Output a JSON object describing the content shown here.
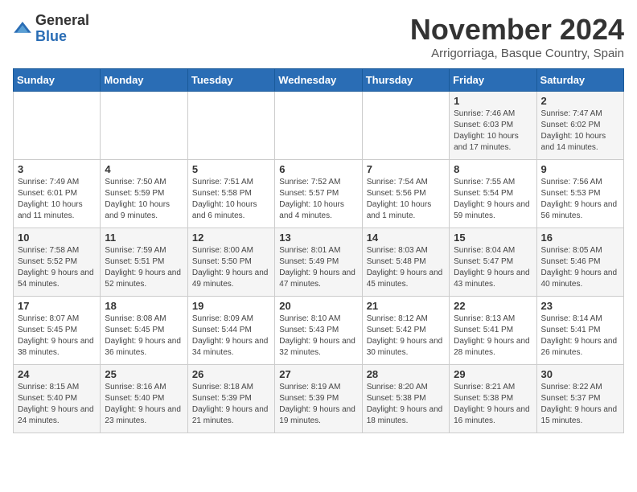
{
  "logo": {
    "general": "General",
    "blue": "Blue"
  },
  "title": "November 2024",
  "location": "Arrigorriaga, Basque Country, Spain",
  "days_of_week": [
    "Sunday",
    "Monday",
    "Tuesday",
    "Wednesday",
    "Thursday",
    "Friday",
    "Saturday"
  ],
  "weeks": [
    [
      {
        "day": "",
        "info": ""
      },
      {
        "day": "",
        "info": ""
      },
      {
        "day": "",
        "info": ""
      },
      {
        "day": "",
        "info": ""
      },
      {
        "day": "",
        "info": ""
      },
      {
        "day": "1",
        "info": "Sunrise: 7:46 AM\nSunset: 6:03 PM\nDaylight: 10 hours and 17 minutes."
      },
      {
        "day": "2",
        "info": "Sunrise: 7:47 AM\nSunset: 6:02 PM\nDaylight: 10 hours and 14 minutes."
      }
    ],
    [
      {
        "day": "3",
        "info": "Sunrise: 7:49 AM\nSunset: 6:01 PM\nDaylight: 10 hours and 11 minutes."
      },
      {
        "day": "4",
        "info": "Sunrise: 7:50 AM\nSunset: 5:59 PM\nDaylight: 10 hours and 9 minutes."
      },
      {
        "day": "5",
        "info": "Sunrise: 7:51 AM\nSunset: 5:58 PM\nDaylight: 10 hours and 6 minutes."
      },
      {
        "day": "6",
        "info": "Sunrise: 7:52 AM\nSunset: 5:57 PM\nDaylight: 10 hours and 4 minutes."
      },
      {
        "day": "7",
        "info": "Sunrise: 7:54 AM\nSunset: 5:56 PM\nDaylight: 10 hours and 1 minute."
      },
      {
        "day": "8",
        "info": "Sunrise: 7:55 AM\nSunset: 5:54 PM\nDaylight: 9 hours and 59 minutes."
      },
      {
        "day": "9",
        "info": "Sunrise: 7:56 AM\nSunset: 5:53 PM\nDaylight: 9 hours and 56 minutes."
      }
    ],
    [
      {
        "day": "10",
        "info": "Sunrise: 7:58 AM\nSunset: 5:52 PM\nDaylight: 9 hours and 54 minutes."
      },
      {
        "day": "11",
        "info": "Sunrise: 7:59 AM\nSunset: 5:51 PM\nDaylight: 9 hours and 52 minutes."
      },
      {
        "day": "12",
        "info": "Sunrise: 8:00 AM\nSunset: 5:50 PM\nDaylight: 9 hours and 49 minutes."
      },
      {
        "day": "13",
        "info": "Sunrise: 8:01 AM\nSunset: 5:49 PM\nDaylight: 9 hours and 47 minutes."
      },
      {
        "day": "14",
        "info": "Sunrise: 8:03 AM\nSunset: 5:48 PM\nDaylight: 9 hours and 45 minutes."
      },
      {
        "day": "15",
        "info": "Sunrise: 8:04 AM\nSunset: 5:47 PM\nDaylight: 9 hours and 43 minutes."
      },
      {
        "day": "16",
        "info": "Sunrise: 8:05 AM\nSunset: 5:46 PM\nDaylight: 9 hours and 40 minutes."
      }
    ],
    [
      {
        "day": "17",
        "info": "Sunrise: 8:07 AM\nSunset: 5:45 PM\nDaylight: 9 hours and 38 minutes."
      },
      {
        "day": "18",
        "info": "Sunrise: 8:08 AM\nSunset: 5:45 PM\nDaylight: 9 hours and 36 minutes."
      },
      {
        "day": "19",
        "info": "Sunrise: 8:09 AM\nSunset: 5:44 PM\nDaylight: 9 hours and 34 minutes."
      },
      {
        "day": "20",
        "info": "Sunrise: 8:10 AM\nSunset: 5:43 PM\nDaylight: 9 hours and 32 minutes."
      },
      {
        "day": "21",
        "info": "Sunrise: 8:12 AM\nSunset: 5:42 PM\nDaylight: 9 hours and 30 minutes."
      },
      {
        "day": "22",
        "info": "Sunrise: 8:13 AM\nSunset: 5:41 PM\nDaylight: 9 hours and 28 minutes."
      },
      {
        "day": "23",
        "info": "Sunrise: 8:14 AM\nSunset: 5:41 PM\nDaylight: 9 hours and 26 minutes."
      }
    ],
    [
      {
        "day": "24",
        "info": "Sunrise: 8:15 AM\nSunset: 5:40 PM\nDaylight: 9 hours and 24 minutes."
      },
      {
        "day": "25",
        "info": "Sunrise: 8:16 AM\nSunset: 5:40 PM\nDaylight: 9 hours and 23 minutes."
      },
      {
        "day": "26",
        "info": "Sunrise: 8:18 AM\nSunset: 5:39 PM\nDaylight: 9 hours and 21 minutes."
      },
      {
        "day": "27",
        "info": "Sunrise: 8:19 AM\nSunset: 5:39 PM\nDaylight: 9 hours and 19 minutes."
      },
      {
        "day": "28",
        "info": "Sunrise: 8:20 AM\nSunset: 5:38 PM\nDaylight: 9 hours and 18 minutes."
      },
      {
        "day": "29",
        "info": "Sunrise: 8:21 AM\nSunset: 5:38 PM\nDaylight: 9 hours and 16 minutes."
      },
      {
        "day": "30",
        "info": "Sunrise: 8:22 AM\nSunset: 5:37 PM\nDaylight: 9 hours and 15 minutes."
      }
    ]
  ]
}
